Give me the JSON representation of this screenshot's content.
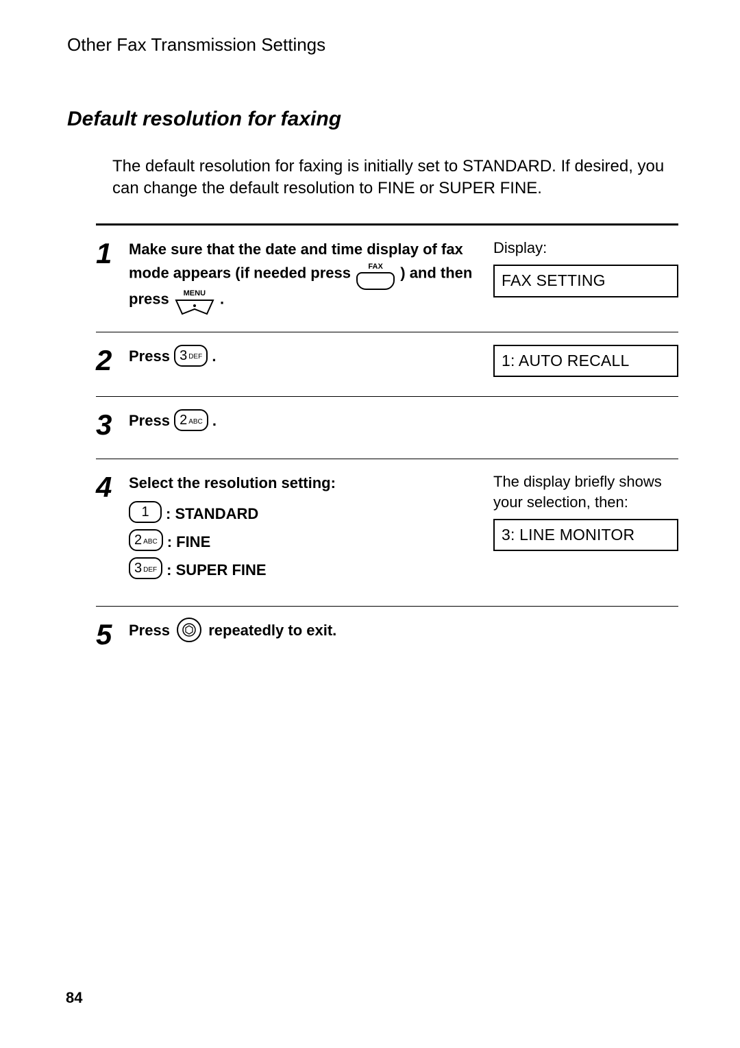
{
  "header": "Other Fax Transmission Settings",
  "section_title": "Default resolution for faxing",
  "intro": "The default resolution for faxing is initially set to STANDARD.  If desired, you can change the default resolution to FINE or SUPER FINE.",
  "page_number": "84",
  "keys": {
    "fax_label": "FAX",
    "menu_label": "MENU",
    "k1_main": "1",
    "k1_sub": "",
    "k2_main": "2",
    "k2_sub": "ABC",
    "k3_main": "3",
    "k3_sub": "DEF"
  },
  "steps": {
    "s1": {
      "num": "1",
      "text_a": "Make sure that the date and time display of fax mode appears (if needed press",
      "text_b": ") and then press",
      "text_c": ".",
      "side_label": "Display:",
      "side_box": "FAX SETTING"
    },
    "s2": {
      "num": "2",
      "text_a": "Press",
      "text_b": ".",
      "side_box": "1: AUTO RECALL"
    },
    "s3": {
      "num": "3",
      "text_a": "Press",
      "text_b": "."
    },
    "s4": {
      "num": "4",
      "heading": "Select the resolution setting:",
      "opt1": ": STANDARD",
      "opt2": ": FINE",
      "opt3": ": SUPER FINE",
      "side_text": "The display briefly shows your selection, then:",
      "side_box": "3: LINE MONITOR"
    },
    "s5": {
      "num": "5",
      "text_a": "Press",
      "text_b": "repeatedly to exit."
    }
  }
}
